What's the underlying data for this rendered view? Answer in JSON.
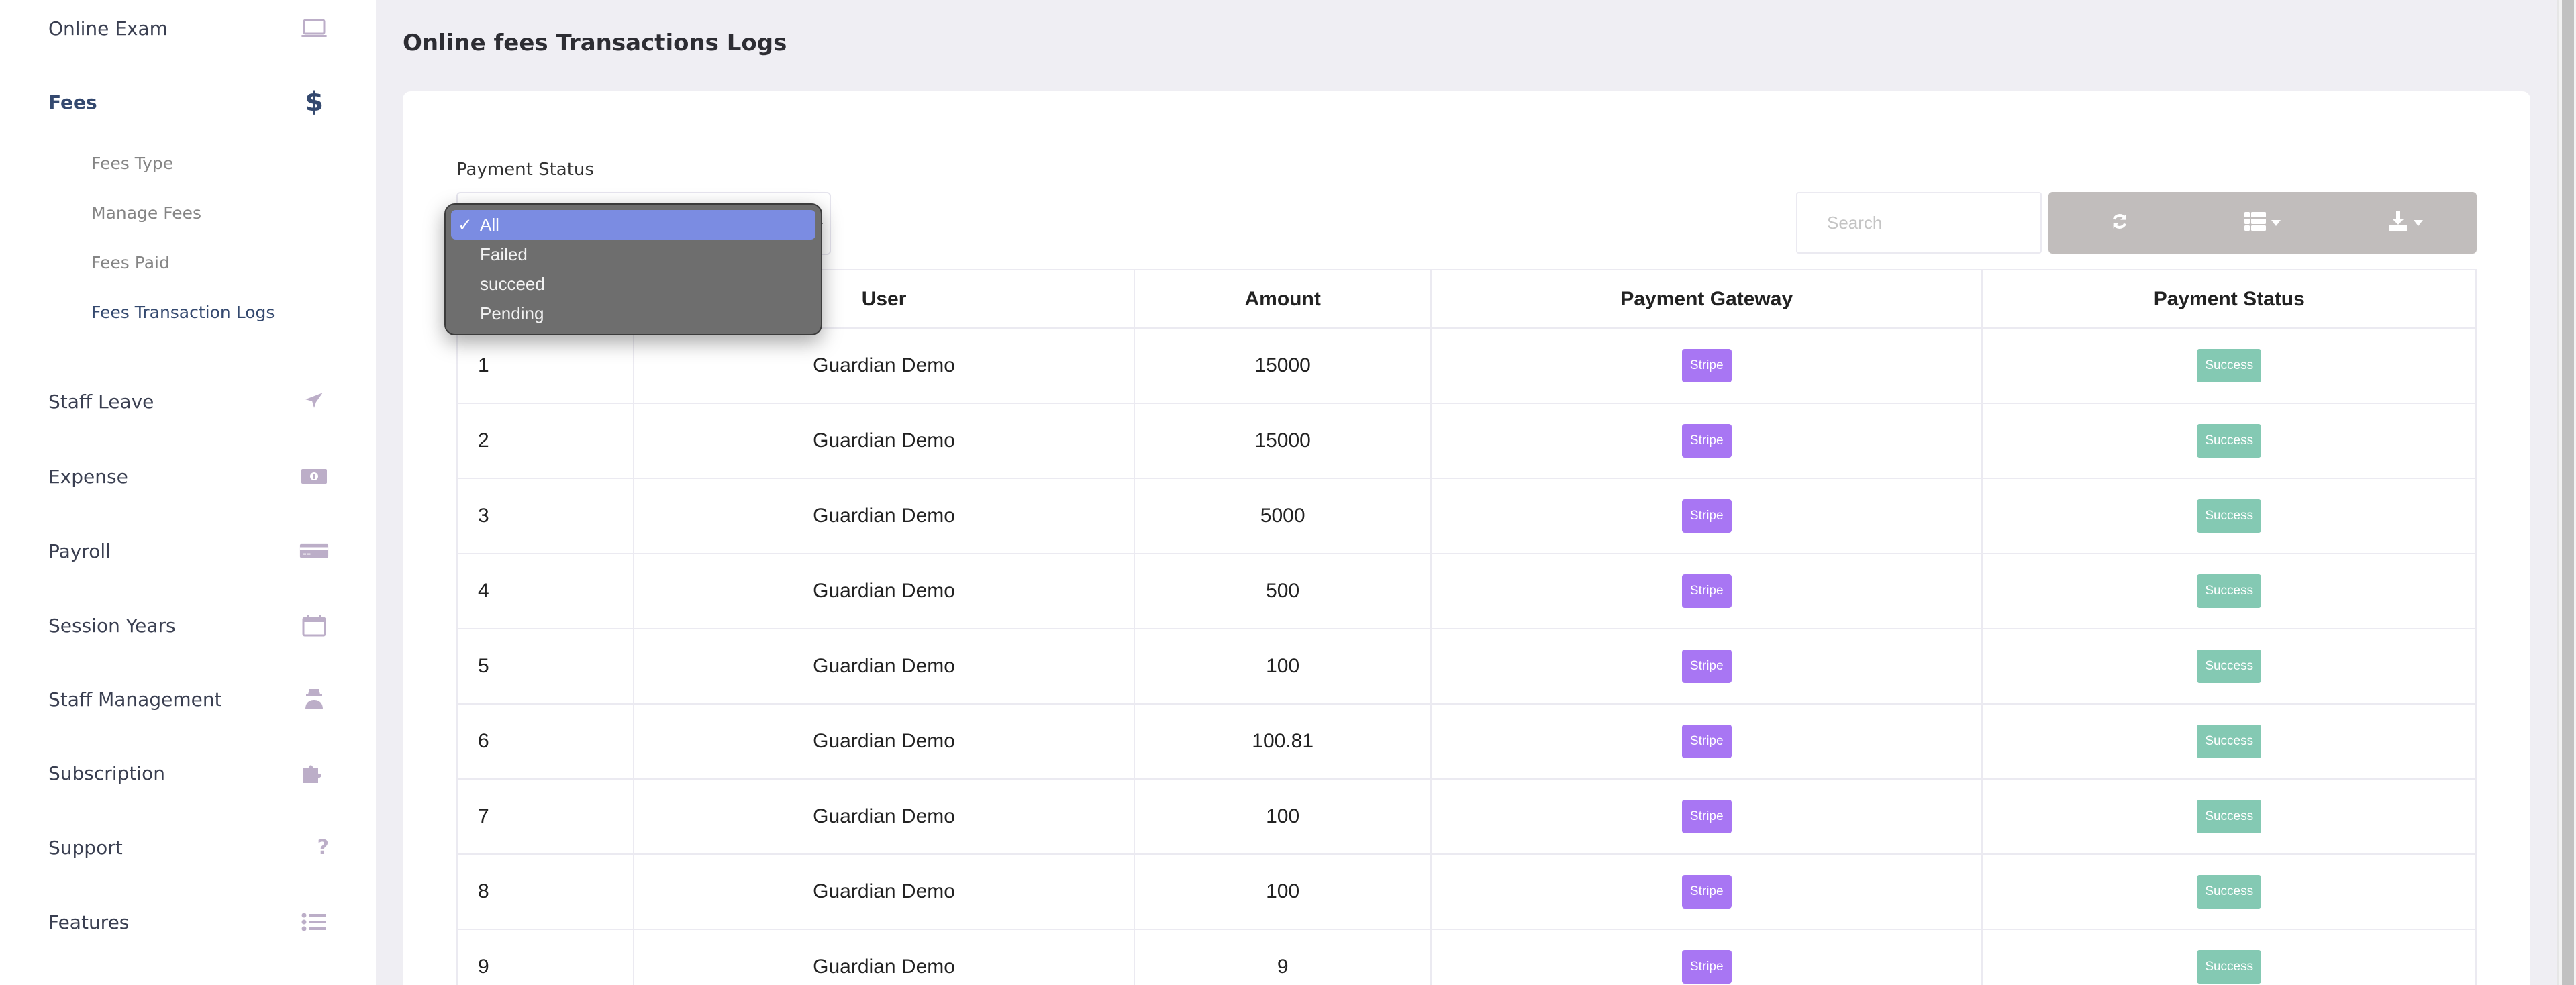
{
  "sidebar": {
    "items": [
      {
        "label": "Online Exam",
        "icon": "laptop-icon",
        "active": false
      },
      {
        "label": "Fees",
        "icon": "dollar-icon",
        "active": true
      },
      {
        "label": "Staff Leave",
        "icon": "plane-icon",
        "active": false
      },
      {
        "label": "Expense",
        "icon": "money-bill-icon",
        "active": false
      },
      {
        "label": "Payroll",
        "icon": "credit-card-icon",
        "active": false
      },
      {
        "label": "Session Years",
        "icon": "calendar-icon",
        "active": false
      },
      {
        "label": "Staff Management",
        "icon": "user-secret-icon",
        "active": false
      },
      {
        "label": "Subscription",
        "icon": "puzzle-icon",
        "active": false
      },
      {
        "label": "Support",
        "icon": "question-icon",
        "active": false
      },
      {
        "label": "Features",
        "icon": "list-icon",
        "active": false
      }
    ],
    "fees_submenu": [
      {
        "label": "Fees Type",
        "active": false
      },
      {
        "label": "Manage Fees",
        "active": false
      },
      {
        "label": "Fees Paid",
        "active": false
      },
      {
        "label": "Fees Transaction Logs",
        "active": true
      }
    ]
  },
  "page": {
    "title": "Online fees Transactions Logs"
  },
  "filter": {
    "label": "Payment Status",
    "selected": "All",
    "options": [
      "All",
      "Failed",
      "succeed",
      "Pending"
    ],
    "check_glyph": "✓"
  },
  "toolbar": {
    "search_placeholder": "Search",
    "buttons": [
      {
        "name": "refresh",
        "icon": "refresh-icon"
      },
      {
        "name": "columns",
        "icon": "columns-list-icon",
        "dropdown": true
      },
      {
        "name": "export",
        "icon": "download-icon",
        "dropdown": true
      }
    ]
  },
  "table": {
    "columns": [
      "",
      "User",
      "Amount",
      "Payment Gateway",
      "Payment Status"
    ],
    "rows": [
      {
        "no": "1",
        "user": "Guardian Demo",
        "amount": "15000",
        "gateway": "Stripe",
        "status": "Success"
      },
      {
        "no": "2",
        "user": "Guardian Demo",
        "amount": "15000",
        "gateway": "Stripe",
        "status": "Success"
      },
      {
        "no": "3",
        "user": "Guardian Demo",
        "amount": "5000",
        "gateway": "Stripe",
        "status": "Success"
      },
      {
        "no": "4",
        "user": "Guardian Demo",
        "amount": "500",
        "gateway": "Stripe",
        "status": "Success"
      },
      {
        "no": "5",
        "user": "Guardian Demo",
        "amount": "100",
        "gateway": "Stripe",
        "status": "Success"
      },
      {
        "no": "6",
        "user": "Guardian Demo",
        "amount": "100.81",
        "gateway": "Stripe",
        "status": "Success"
      },
      {
        "no": "7",
        "user": "Guardian Demo",
        "amount": "100",
        "gateway": "Stripe",
        "status": "Success"
      },
      {
        "no": "8",
        "user": "Guardian Demo",
        "amount": "100",
        "gateway": "Stripe",
        "status": "Success"
      },
      {
        "no": "9",
        "user": "Guardian Demo",
        "amount": "9",
        "gateway": "Stripe",
        "status": "Success"
      }
    ]
  },
  "colors": {
    "accent_active": "#34496f",
    "gateway_badge": "#a876f3",
    "success_badge": "#84c9b3",
    "dropdown_selected": "#7b8ce2",
    "toolbar_button": "#c1bdbc"
  }
}
